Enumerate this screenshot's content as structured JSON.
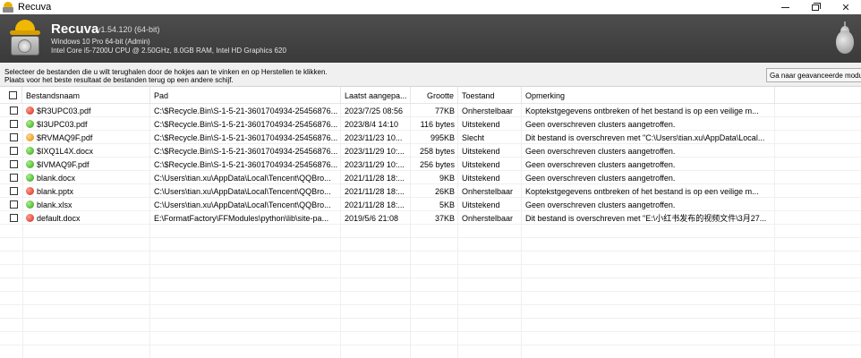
{
  "window": {
    "title": "Recuva",
    "minimize_glyph": "",
    "maximize_glyph": "",
    "close_glyph": "✕"
  },
  "header": {
    "app_name": "Recuva",
    "version": "v1.54.120 (64-bit)",
    "sys_line1": "Windows 10 Pro 64-bit (Admin)",
    "sys_line2": "Intel Core i5-7200U CPU @ 2.50GHz, 8.0GB RAM, Intel HD Graphics 620"
  },
  "instructions": {
    "line1": "Selecteer de bestanden die u wilt terughalen door de hokjes aan te vinken en op Herstellen te klikken.",
    "line2": "Plaats voor het beste resultaat de bestanden terug op een andere schijf.",
    "advanced_button": "Ga naar geavanceerde modus"
  },
  "columns": {
    "filename": "Bestandsnaam",
    "path": "Pad",
    "modified": "Laatst aangepa...",
    "size": "Grootte",
    "state": "Toestand",
    "comment": "Opmerking"
  },
  "rows": [
    {
      "status": "red",
      "name": "$R3UPC03.pdf",
      "path": "C:\\$Recycle.Bin\\S-1-5-21-3601704934-25456876...",
      "modified": "2023/7/25 08:56",
      "size": "77KB",
      "state": "Onherstelbaar",
      "comment": "Koptekstgegevens ontbreken of het bestand is op een veilige m..."
    },
    {
      "status": "green",
      "name": "$I3UPC03.pdf",
      "path": "C:\\$Recycle.Bin\\S-1-5-21-3601704934-25456876...",
      "modified": "2023/8/4 14:10",
      "size": "116 bytes",
      "state": "Uitstekend",
      "comment": "Geen overschreven clusters aangetroffen."
    },
    {
      "status": "orange",
      "name": "$RVMAQ9F.pdf",
      "path": "C:\\$Recycle.Bin\\S-1-5-21-3601704934-25456876...",
      "modified": "2023/11/23 10...",
      "size": "995KB",
      "state": "Slecht",
      "comment": "Dit bestand is overschreven met \"C:\\Users\\tian.xu\\AppData\\Local..."
    },
    {
      "status": "green",
      "name": "$IXQ1L4X.docx",
      "path": "C:\\$Recycle.Bin\\S-1-5-21-3601704934-25456876...",
      "modified": "2023/11/29 10:...",
      "size": "258 bytes",
      "state": "Uitstekend",
      "comment": "Geen overschreven clusters aangetroffen."
    },
    {
      "status": "green",
      "name": "$IVMAQ9F.pdf",
      "path": "C:\\$Recycle.Bin\\S-1-5-21-3601704934-25456876...",
      "modified": "2023/11/29 10:...",
      "size": "256 bytes",
      "state": "Uitstekend",
      "comment": "Geen overschreven clusters aangetroffen."
    },
    {
      "status": "green",
      "name": "blank.docx",
      "path": "C:\\Users\\tian.xu\\AppData\\Local\\Tencent\\QQBro...",
      "modified": "2021/11/28 18:...",
      "size": "9KB",
      "state": "Uitstekend",
      "comment": "Geen overschreven clusters aangetroffen."
    },
    {
      "status": "red",
      "name": "blank.pptx",
      "path": "C:\\Users\\tian.xu\\AppData\\Local\\Tencent\\QQBro...",
      "modified": "2021/11/28 18:...",
      "size": "26KB",
      "state": "Onherstelbaar",
      "comment": "Koptekstgegevens ontbreken of het bestand is op een veilige m..."
    },
    {
      "status": "green",
      "name": "blank.xlsx",
      "path": "C:\\Users\\tian.xu\\AppData\\Local\\Tencent\\QQBro...",
      "modified": "2021/11/28 18:...",
      "size": "5KB",
      "state": "Uitstekend",
      "comment": "Geen overschreven clusters aangetroffen."
    },
    {
      "status": "red",
      "name": "default.docx",
      "path": "E:\\FormatFactory\\FFModules\\python\\lib\\site-pa...",
      "modified": "2019/5/6 21:08",
      "size": "37KB",
      "state": "Onherstelbaar",
      "comment": "Dit bestand is overschreven met \"E:\\小红书发布的视频文件\\3月27..."
    }
  ],
  "colors": {
    "header_bg": "#444444",
    "status_red": "#d0281a",
    "status_green": "#2fa012",
    "status_orange": "#e58a00"
  },
  "icons": {
    "app": "recuva-hat-drive-icon",
    "pear": "piriform-pear-icon"
  }
}
